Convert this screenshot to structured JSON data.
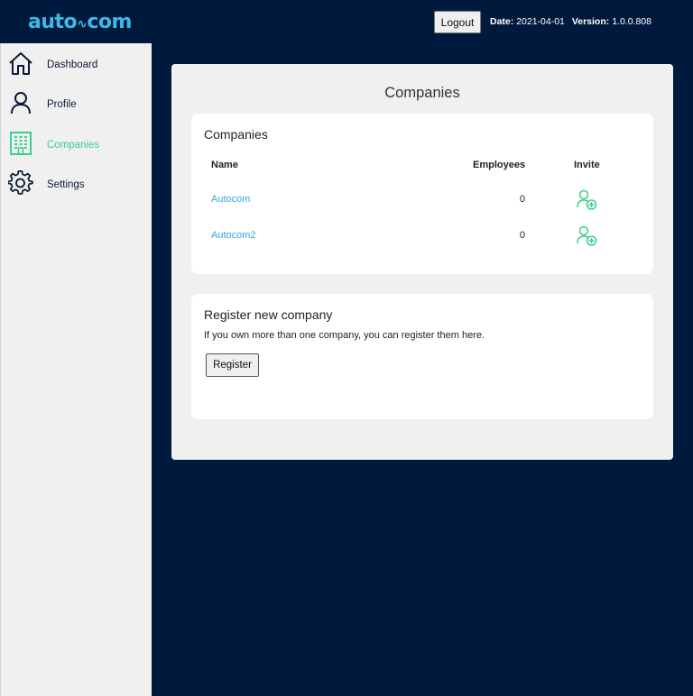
{
  "header": {
    "logo_text_left": "auto",
    "logo_text_right": "com",
    "logout_label": "Logout",
    "date_label": "Date:",
    "date_value": "2021-04-01",
    "version_label": "Version:",
    "version_value": "1.0.0.808"
  },
  "sidebar": {
    "items": [
      {
        "label": "Dashboard",
        "icon": "home-icon"
      },
      {
        "label": "Profile",
        "icon": "user-icon"
      },
      {
        "label": "Companies",
        "icon": "building-icon",
        "active": true
      },
      {
        "label": "Settings",
        "icon": "gear-icon"
      }
    ]
  },
  "main": {
    "title": "Companies",
    "companies_card": {
      "title": "Companies",
      "columns": [
        "Name",
        "Employees",
        "Invite"
      ],
      "rows": [
        {
          "name": "Autocom",
          "employees": "0"
        },
        {
          "name": "Autocom2",
          "employees": "0"
        }
      ]
    },
    "register_card": {
      "title": "Register new company",
      "description": "If you own more than one company, you can register them here.",
      "button_label": "Register"
    }
  },
  "colors": {
    "background": "#001a3e",
    "accent_blue": "#34a9e0",
    "accent_green": "#3ad08f",
    "sidebar_bg": "#f0f0f0"
  }
}
